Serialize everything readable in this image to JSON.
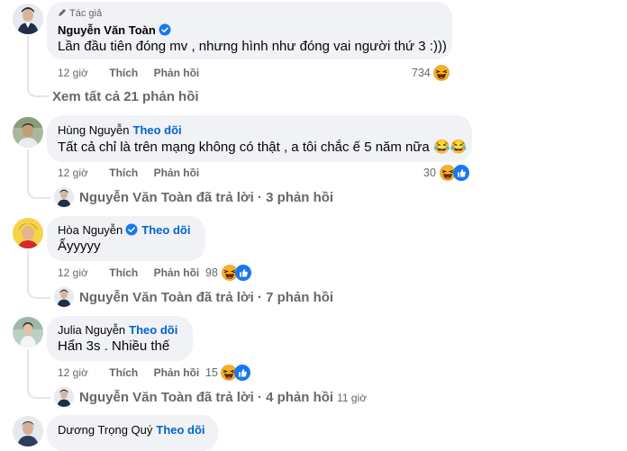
{
  "comments": [
    {
      "author_tag": "Tác giả",
      "author": "Nguyễn Văn Toàn",
      "verified": true,
      "text": "Lần đầu tiên đóng mv , nhưng hình như đóng vai người thứ 3 :)))",
      "time": "12 giờ",
      "like": "Thích",
      "reply": "Phản hồi",
      "reactions": "734",
      "view_replies": "Xem tất cả 21 phản hồi"
    },
    {
      "author": "Hùng Nguyễn",
      "follow": "Theo dõi",
      "text": "Tất cả chỉ là trên mạng không có thật , a tôi chắc ế 5 năm nữa 😂😂",
      "time": "12 giờ",
      "like": "Thích",
      "reply": "Phản hồi",
      "reactions": "30",
      "replied": "Nguyễn Văn Toàn đã trả lời · 3 phản hồi"
    },
    {
      "author": "Hòa Nguyễn",
      "verified": true,
      "follow": "Theo dõi",
      "text": "Ẩyyyyy",
      "time": "12 giờ",
      "like": "Thích",
      "reply": "Phản hồi",
      "reactions": "98",
      "replied": "Nguyễn Văn Toàn đã trả lời · 7 phản hồi"
    },
    {
      "author": "Julia Nguyễn",
      "follow": "Theo dõi",
      "text": "Hẩn 3s . Nhiều thế",
      "time": "12 giờ",
      "like": "Thích",
      "reply": "Phản hồi",
      "reactions": "15",
      "replied": "Nguyễn Văn Toàn đã trả lời · 4 phản hồi",
      "replied_time": "11 giờ"
    },
    {
      "author": "Dương Trọng Quý",
      "follow": "Theo dõi"
    }
  ],
  "icons": {
    "haha": "haha-emoji-icon",
    "like": "like-reaction-icon",
    "verified": "verified-badge-icon",
    "author_badge": "pen-icon"
  },
  "colors": {
    "bubble": "#f0f2f5",
    "link": "#0064d1",
    "meta": "#65676b",
    "verified": "#1877f2"
  }
}
